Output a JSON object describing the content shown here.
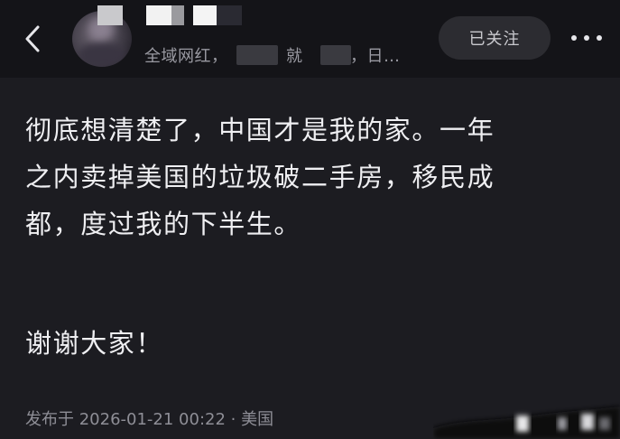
{
  "header": {
    "subtitle_prefix": "全域网红，",
    "subtitle_mid": "，就",
    "subtitle_mid2": "业，日…",
    "follow_label": "已关注",
    "icons": {
      "back": "chevron-left-icon",
      "more": "more-horizontal-icon"
    }
  },
  "post": {
    "lines": [
      "彻底想清楚了，中国才是我的家。一年",
      "之内卖掉美国的垃圾破二手房，移民成",
      "都，度过我的下半生。"
    ],
    "closing": "谢谢大家！",
    "meta": "发布于 2026-01-21 00:22 · 美国"
  },
  "colors": {
    "background": "#1c1c21",
    "header_background": "#141418",
    "text": "#efeff2",
    "muted": "#8e8e96",
    "button_bg": "#2c2c31"
  }
}
